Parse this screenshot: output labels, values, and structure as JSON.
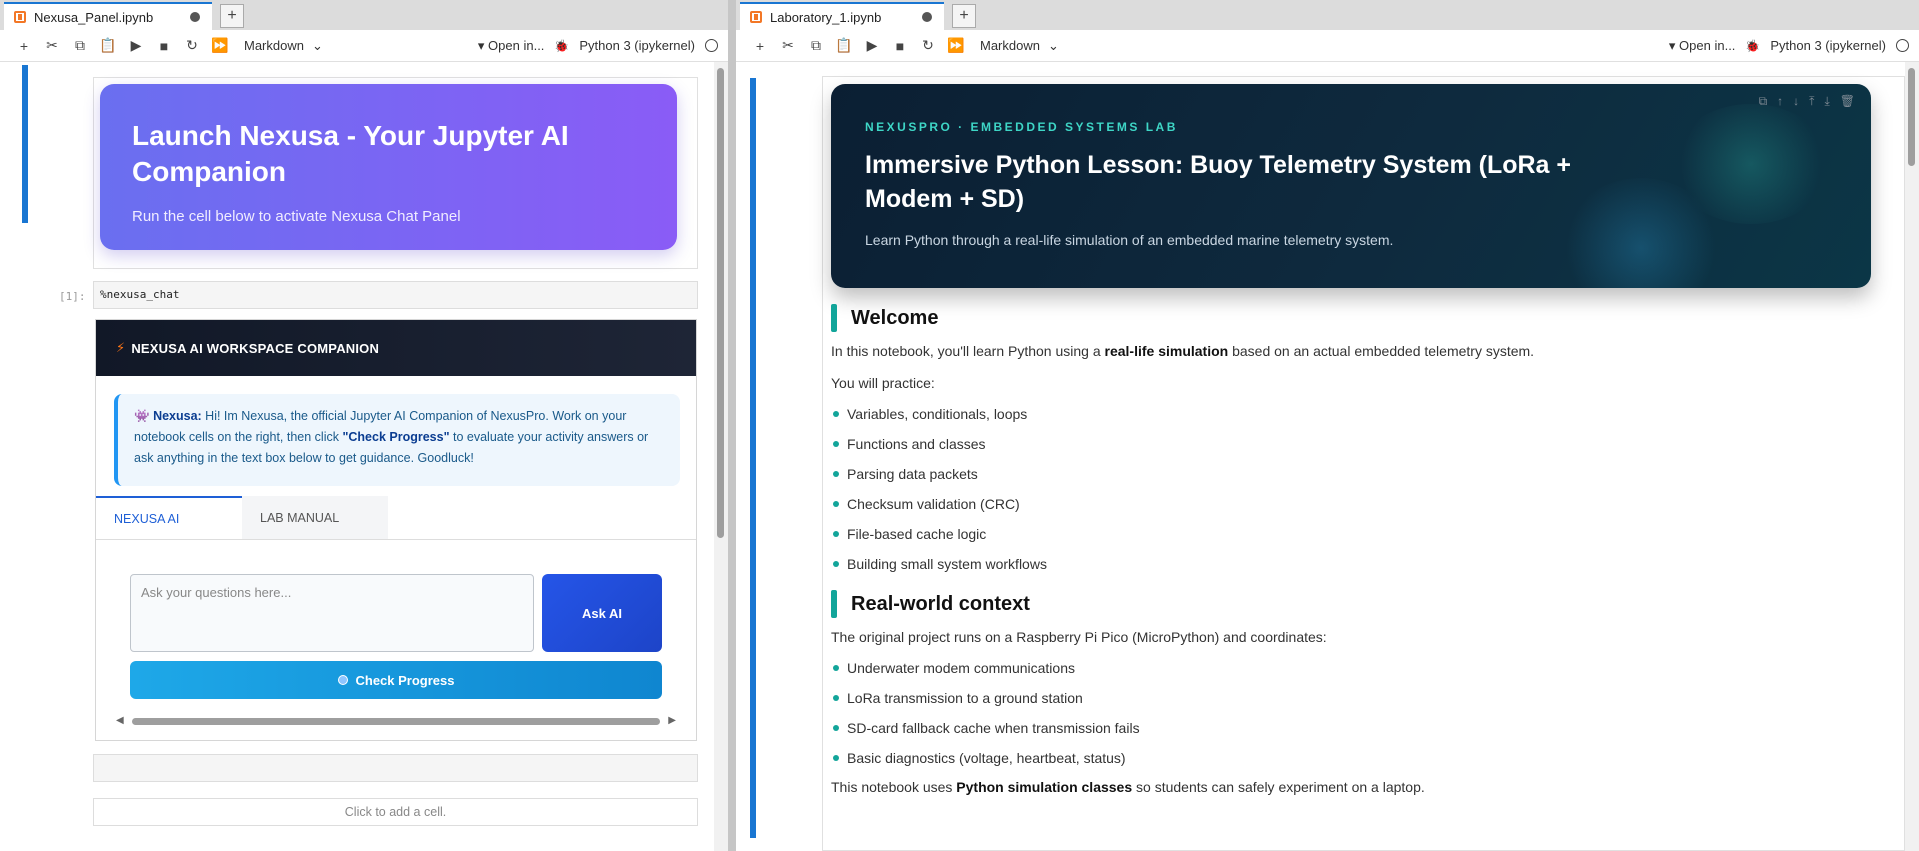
{
  "left": {
    "tab_title": "Nexusa_Panel.ipynb",
    "cell_type": "Markdown",
    "open_in": "Open in...",
    "kernel": "Python 3 (ipykernel)",
    "hero": {
      "title": "Launch Nexusa - Your Jupyter AI Companion",
      "subtitle": "Run the cell below to activate Nexusa Chat Panel"
    },
    "code_prompt": "[1]:",
    "code": "%nexusa_chat",
    "widget": {
      "header": "NEXUSA AI WORKSPACE COMPANION",
      "bot_name": "Nexusa:",
      "message_a": " Hi! Im Nexusa, the official Jupyter AI Companion of NexusPro. Work on your notebook cells on the right, then click ",
      "message_bold": "\"Check Progress\"",
      "message_b": " to evaluate your activity answers or ask anything in the text box below to get guidance. Goodluck!",
      "tabs": [
        "NEXUSA AI",
        "LAB MANUAL"
      ],
      "input_placeholder": "Ask your questions here...",
      "ask_label": "Ask AI",
      "check_label": "Check Progress"
    },
    "add_cell": "Click to add a cell."
  },
  "right": {
    "tab_title": "Laboratory_1.ipynb",
    "cell_type": "Markdown",
    "open_in": "Open in...",
    "kernel": "Python 3 (ipykernel)",
    "hero": {
      "kicker": "NEXUSPRO · EMBEDDED SYSTEMS LAB",
      "title": "Immersive Python Lesson: Buoy Telemetry System (LoRa + Modem + SD)",
      "subtitle": "Learn Python through a real-life simulation of an embedded marine telemetry system."
    },
    "welcome": {
      "heading": "Welcome",
      "intro_a": "In this notebook, you'll learn Python using a ",
      "intro_bold": "real-life simulation",
      "intro_b": " based on an actual embedded telemetry system.",
      "practice": "You will practice:",
      "items": [
        "Variables, conditionals, loops",
        "Functions and classes",
        "Parsing data packets",
        "Checksum validation (CRC)",
        "File-based cache logic",
        "Building small system workflows"
      ]
    },
    "context": {
      "heading": "Real-world context",
      "intro": "The original project runs on a Raspberry Pi Pico (MicroPython) and coordinates:",
      "items": [
        "Underwater modem communications",
        "LoRa transmission to a ground station",
        "SD-card fallback cache when transmission fails",
        "Basic diagnostics (voltage, heartbeat, status)"
      ],
      "outro_a": "This notebook uses ",
      "outro_bold": "Python simulation classes",
      "outro_b": " so students can safely experiment on a laptop."
    }
  }
}
